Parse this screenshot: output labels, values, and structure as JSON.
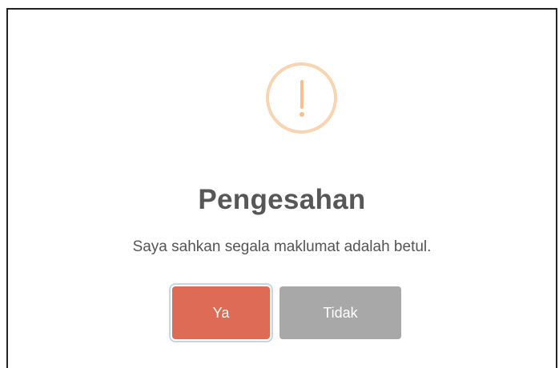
{
  "dialog": {
    "icon": "warning-exclamation-icon",
    "title": "Pengesahan",
    "message": "Saya sahkan segala maklumat adalah betul.",
    "confirm_label": "Ya",
    "cancel_label": "Tidak",
    "colors": {
      "icon": "#f8bb86",
      "confirm": "#dd6b55",
      "cancel": "#aaaaaa",
      "title": "#575757"
    }
  }
}
